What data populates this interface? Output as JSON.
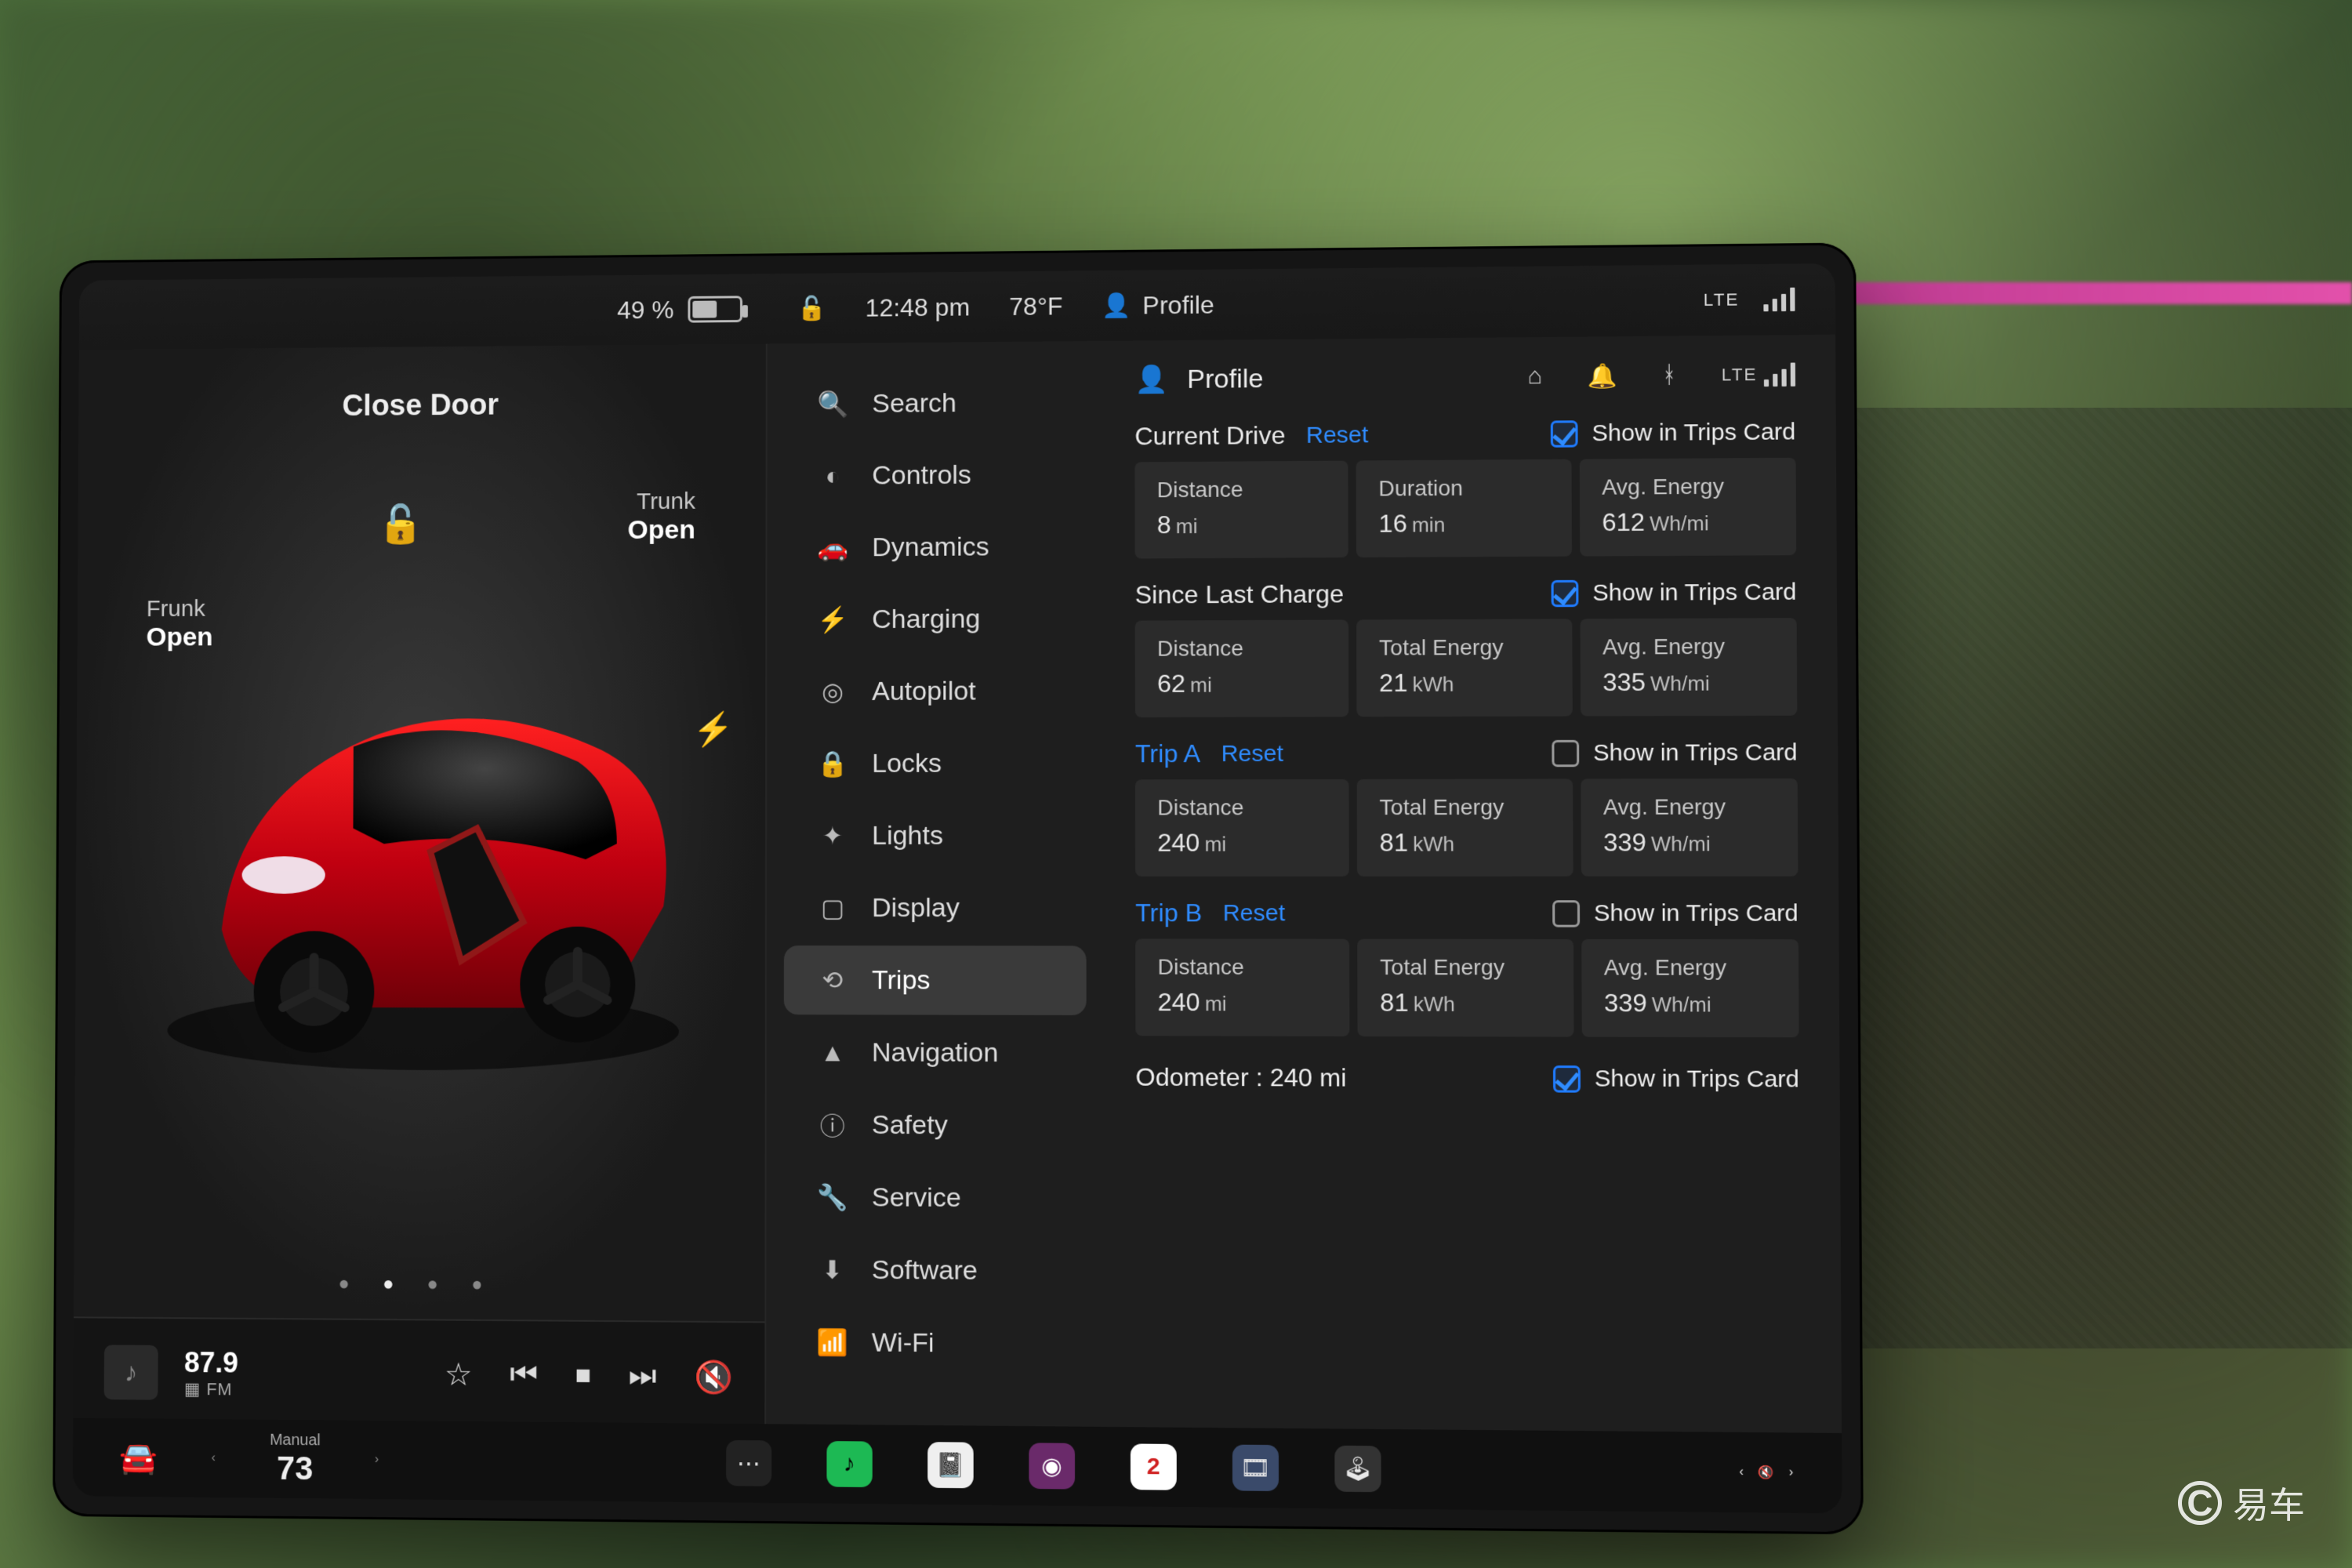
{
  "statusbar": {
    "battery_pct": "49 %",
    "time": "12:48 pm",
    "temp": "78°F",
    "profile_label": "Profile",
    "net_label": "LTE"
  },
  "car_pane": {
    "close_door": "Close Door",
    "frunk_label": "Frunk",
    "frunk_state": "Open",
    "trunk_label": "Trunk",
    "trunk_state": "Open"
  },
  "nowplaying": {
    "freq": "87.9",
    "band": "FM"
  },
  "nav": {
    "search": "Search",
    "controls": "Controls",
    "dynamics": "Dynamics",
    "charging": "Charging",
    "autopilot": "Autopilot",
    "locks": "Locks",
    "lights": "Lights",
    "display": "Display",
    "trips": "Trips",
    "navigation": "Navigation",
    "safety": "Safety",
    "service": "Service",
    "software": "Software",
    "wifi": "Wi-Fi"
  },
  "content": {
    "header": "Profile",
    "show_label": "Show in Trips Card",
    "reset": "Reset",
    "current": {
      "title": "Current Drive",
      "distance_lbl": "Distance",
      "distance_val": "8",
      "distance_unit": "mi",
      "duration_lbl": "Duration",
      "duration_val": "16",
      "duration_unit": "min",
      "avg_lbl": "Avg. Energy",
      "avg_val": "612",
      "avg_unit": "Wh/mi",
      "show": true
    },
    "charge": {
      "title": "Since Last Charge",
      "distance_lbl": "Distance",
      "distance_val": "62",
      "distance_unit": "mi",
      "energy_lbl": "Total Energy",
      "energy_val": "21",
      "energy_unit": "kWh",
      "avg_lbl": "Avg. Energy",
      "avg_val": "335",
      "avg_unit": "Wh/mi",
      "show": true
    },
    "tripA": {
      "title": "Trip A",
      "distance_lbl": "Distance",
      "distance_val": "240",
      "distance_unit": "mi",
      "energy_lbl": "Total Energy",
      "energy_val": "81",
      "energy_unit": "kWh",
      "avg_lbl": "Avg. Energy",
      "avg_val": "339",
      "avg_unit": "Wh/mi",
      "show": false
    },
    "tripB": {
      "title": "Trip B",
      "distance_lbl": "Distance",
      "distance_val": "240",
      "distance_unit": "mi",
      "energy_lbl": "Total Energy",
      "energy_val": "81",
      "energy_unit": "kWh",
      "avg_lbl": "Avg. Energy",
      "avg_val": "339",
      "avg_unit": "Wh/mi",
      "show": false
    },
    "odometer_lbl": "Odometer :",
    "odometer_val": "240 mi",
    "odometer_show": true
  },
  "dock": {
    "climate_mode": "Manual",
    "climate_temp": "73"
  },
  "watermark": "易车"
}
